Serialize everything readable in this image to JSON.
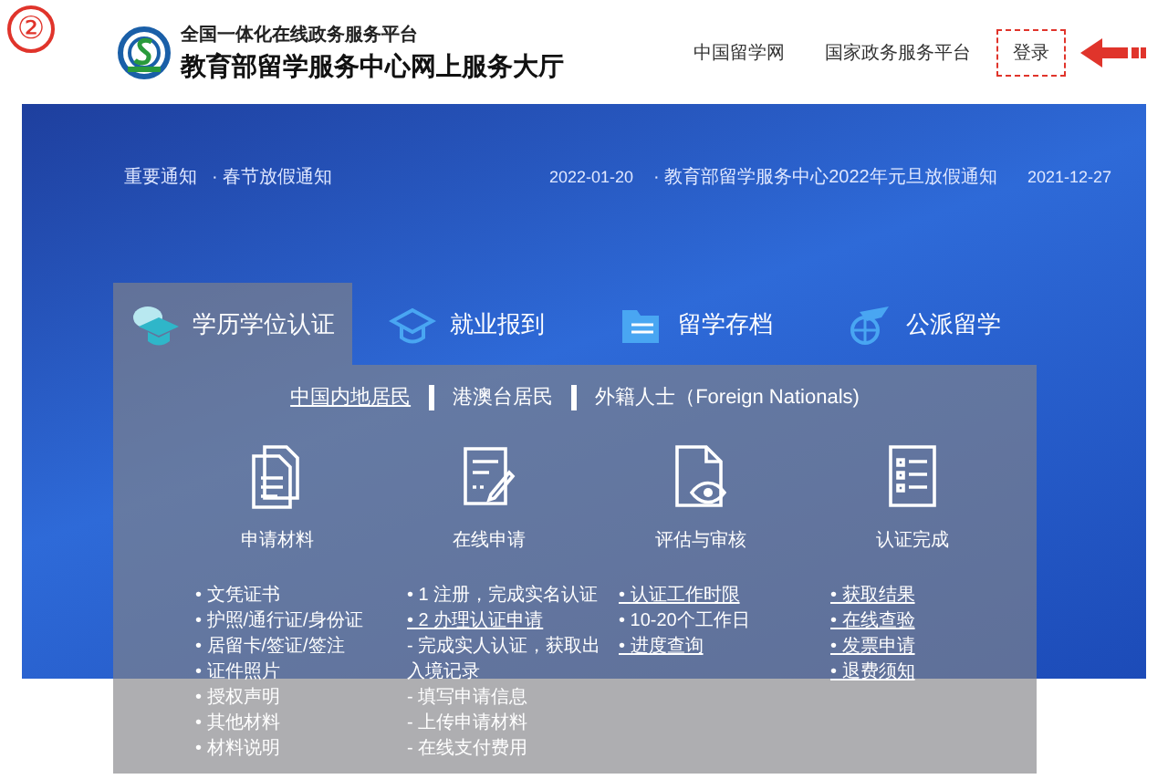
{
  "annotation": {
    "step_number": "②"
  },
  "header": {
    "subtitle": "全国一体化在线政务服务平台",
    "title": "教育部留学服务中心网上服务大厅",
    "links": [
      "中国留学网",
      "国家政务服务平台"
    ],
    "login": {
      "label": "登录",
      "highlighted": true
    }
  },
  "notices": {
    "label": "重要通知",
    "items": [
      {
        "title": "· 春节放假通知",
        "date": "2022-01-20"
      },
      {
        "title": "· 教育部留学服务中心2022年元旦放假通知",
        "date": "2021-12-27"
      }
    ]
  },
  "service_tabs": [
    {
      "label": "学历学位认证",
      "selected": true,
      "kind": "cap"
    },
    {
      "label": "就业报到",
      "selected": false,
      "kind": "cap-outline"
    },
    {
      "label": "留学存档",
      "selected": false,
      "kind": "folder"
    },
    {
      "label": "公派留学",
      "selected": false,
      "kind": "plane"
    }
  ],
  "audience_tabs": [
    {
      "label": "中国内地居民",
      "selected": true
    },
    {
      "label": "港澳台居民",
      "selected": false
    },
    {
      "label": "外籍人士（Foreign Nationals)",
      "selected": false
    }
  ],
  "steps": [
    {
      "title": "申请材料",
      "kind": "documents",
      "items": [
        {
          "text": "• 文凭证书",
          "link": false
        },
        {
          "text": "• 护照/通行证/身份证",
          "link": false
        },
        {
          "text": "• 居留卡/签证/签注",
          "link": false
        },
        {
          "text": "• 证件照片",
          "link": false
        },
        {
          "text": "• 授权声明",
          "link": false
        },
        {
          "text": "• 其他材料",
          "link": false
        },
        {
          "text": "• 材料说明",
          "link": false
        }
      ]
    },
    {
      "title": "在线申请",
      "kind": "form",
      "items": [
        {
          "text": "• 1 注册，完成实名认证",
          "link": false
        },
        {
          "text": "• 2 办理认证申请",
          "link": true
        },
        {
          "text": "- 完成实人认证，获取出",
          "link": false
        },
        {
          "text": "入境记录",
          "link": false
        },
        {
          "text": "- 填写申请信息",
          "link": false
        },
        {
          "text": "- 上传申请材料",
          "link": false
        },
        {
          "text": "- 在线支付费用",
          "link": false
        }
      ]
    },
    {
      "title": "评估与审核",
      "kind": "review",
      "items": [
        {
          "text": "• 认证工作时限",
          "link": true
        },
        {
          "text": "• 10-20个工作日",
          "link": false
        },
        {
          "text": "• 进度查询",
          "link": true
        }
      ]
    },
    {
      "title": "认证完成",
      "kind": "checklist",
      "items": [
        {
          "text": "• 获取结果",
          "link": true
        },
        {
          "text": "• 在线查验",
          "link": true
        },
        {
          "text": "• 发票申请",
          "link": true
        },
        {
          "text": "• 退费须知",
          "link": true
        }
      ]
    }
  ]
}
